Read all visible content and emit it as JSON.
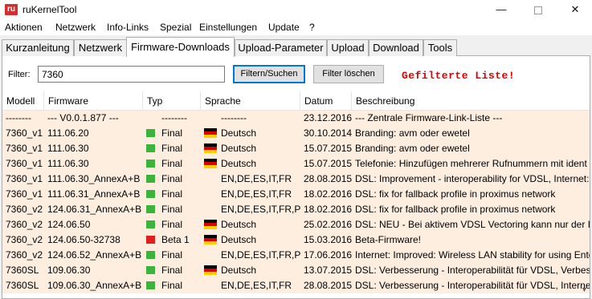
{
  "window": {
    "title": "ruKernelTool",
    "icon_text": "ru"
  },
  "menu": [
    "Aktionen",
    "Netzwerk",
    "Info-Links",
    "Spezial",
    "Einstellungen",
    "Update",
    "?"
  ],
  "tabs": [
    "Kurzanleitung",
    "Netzwerk",
    "Firmware-Downloads",
    "Upload-Parameter",
    "Upload",
    "Download",
    "Tools"
  ],
  "active_tab": "Firmware-Downloads",
  "filter": {
    "label": "Filter:",
    "value": "7360",
    "search_button": "Filtern/Suchen",
    "clear_button": "Filter löschen",
    "status_text": "Gefilterte Liste!"
  },
  "columns": [
    "Modell",
    "Firmware",
    "Typ",
    "Sprache",
    "Datum",
    "Beschreibung"
  ],
  "colors": {
    "row_bg": "#fdeee0",
    "status_red": "#e00000",
    "green_flag": "#3cb43c",
    "red_flag": "#e02020"
  },
  "rows": [
    {
      "modell": "--------",
      "firmware": "--- V0.0.1.877 ---",
      "typ": "--------",
      "typ_flag": "",
      "sprache": "--------",
      "de_flag": false,
      "datum": "23.12.2016",
      "beschreibung": "--- Zentrale Firmware-Link-Liste ---"
    },
    {
      "modell": "7360_v1",
      "firmware": "111.06.20",
      "typ": "Final",
      "typ_flag": "green",
      "sprache": "Deutsch",
      "de_flag": true,
      "datum": "30.10.2014",
      "beschreibung": "Branding: avm oder ewetel"
    },
    {
      "modell": "7360_v1",
      "firmware": "111.06.30",
      "typ": "Final",
      "typ_flag": "green",
      "sprache": "Deutsch",
      "de_flag": true,
      "datum": "15.07.2015",
      "beschreibung": "Branding: avm oder ewetel"
    },
    {
      "modell": "7360_v1",
      "firmware": "111.06.30",
      "typ": "Final",
      "typ_flag": "green",
      "sprache": "Deutsch",
      "de_flag": true,
      "datum": "15.07.2015",
      "beschreibung": "Telefonie: Hinzufügen mehrerer Rufnummern mit ident"
    },
    {
      "modell": "7360_v1",
      "firmware": "111.06.30_AnnexA+B",
      "typ": "Final",
      "typ_flag": "green",
      "sprache": "EN,DE,ES,IT,FR",
      "de_flag": false,
      "datum": "28.08.2015",
      "beschreibung": "DSL: Improvement - interoperability for VDSL, Internet: I"
    },
    {
      "modell": "7360_v1",
      "firmware": "111.06.31_AnnexA+B",
      "typ": "Final",
      "typ_flag": "green",
      "sprache": "EN,DE,ES,IT,FR",
      "de_flag": false,
      "datum": "18.02.2016",
      "beschreibung": "DSL: fix for fallback profile in proximus network"
    },
    {
      "modell": "7360_v2",
      "firmware": "124.06.31_AnnexA+B",
      "typ": "Final",
      "typ_flag": "green",
      "sprache": "EN,DE,ES,IT,FR,PL",
      "de_flag": false,
      "datum": "18.02.2016",
      "beschreibung": "DSL: fix for fallback profile in proximus network"
    },
    {
      "modell": "7360_v2",
      "firmware": "124.06.50",
      "typ": "Final",
      "typ_flag": "green",
      "sprache": "Deutsch",
      "de_flag": true,
      "datum": "25.02.2016",
      "beschreibung": "DSL: NEU - Bei aktivem VDSL Vectoring kann nur der Im"
    },
    {
      "modell": "7360_v2",
      "firmware": "124.06.50-32738",
      "typ": "Beta 1",
      "typ_flag": "red",
      "sprache": "Deutsch",
      "de_flag": true,
      "datum": "15.03.2016",
      "beschreibung": "Beta-Firmware!"
    },
    {
      "modell": "7360_v2",
      "firmware": "124.06.52_AnnexA+B",
      "typ": "Final",
      "typ_flag": "green",
      "sprache": "EN,DE,ES,IT,FR,PL",
      "de_flag": false,
      "datum": "17.06.2016",
      "beschreibung": "Internet: Improved: Wireless LAN stability for using Ente"
    },
    {
      "modell": "7360SL",
      "firmware": "109.06.30",
      "typ": "Final",
      "typ_flag": "green",
      "sprache": "Deutsch",
      "de_flag": true,
      "datum": "13.07.2015",
      "beschreibung": "DSL: Verbesserung - Interoperabilität für VDSL, Verbesser"
    },
    {
      "modell": "7360SL",
      "firmware": "109.06.30_AnnexA+B",
      "typ": "Final",
      "typ_flag": "green",
      "sprache": "EN,DE,ES,IT,FR",
      "de_flag": false,
      "datum": "28.08.2015",
      "beschreibung": "DSL: Verbesserung - Interoperabilität für VDSL, Internet: V"
    }
  ]
}
